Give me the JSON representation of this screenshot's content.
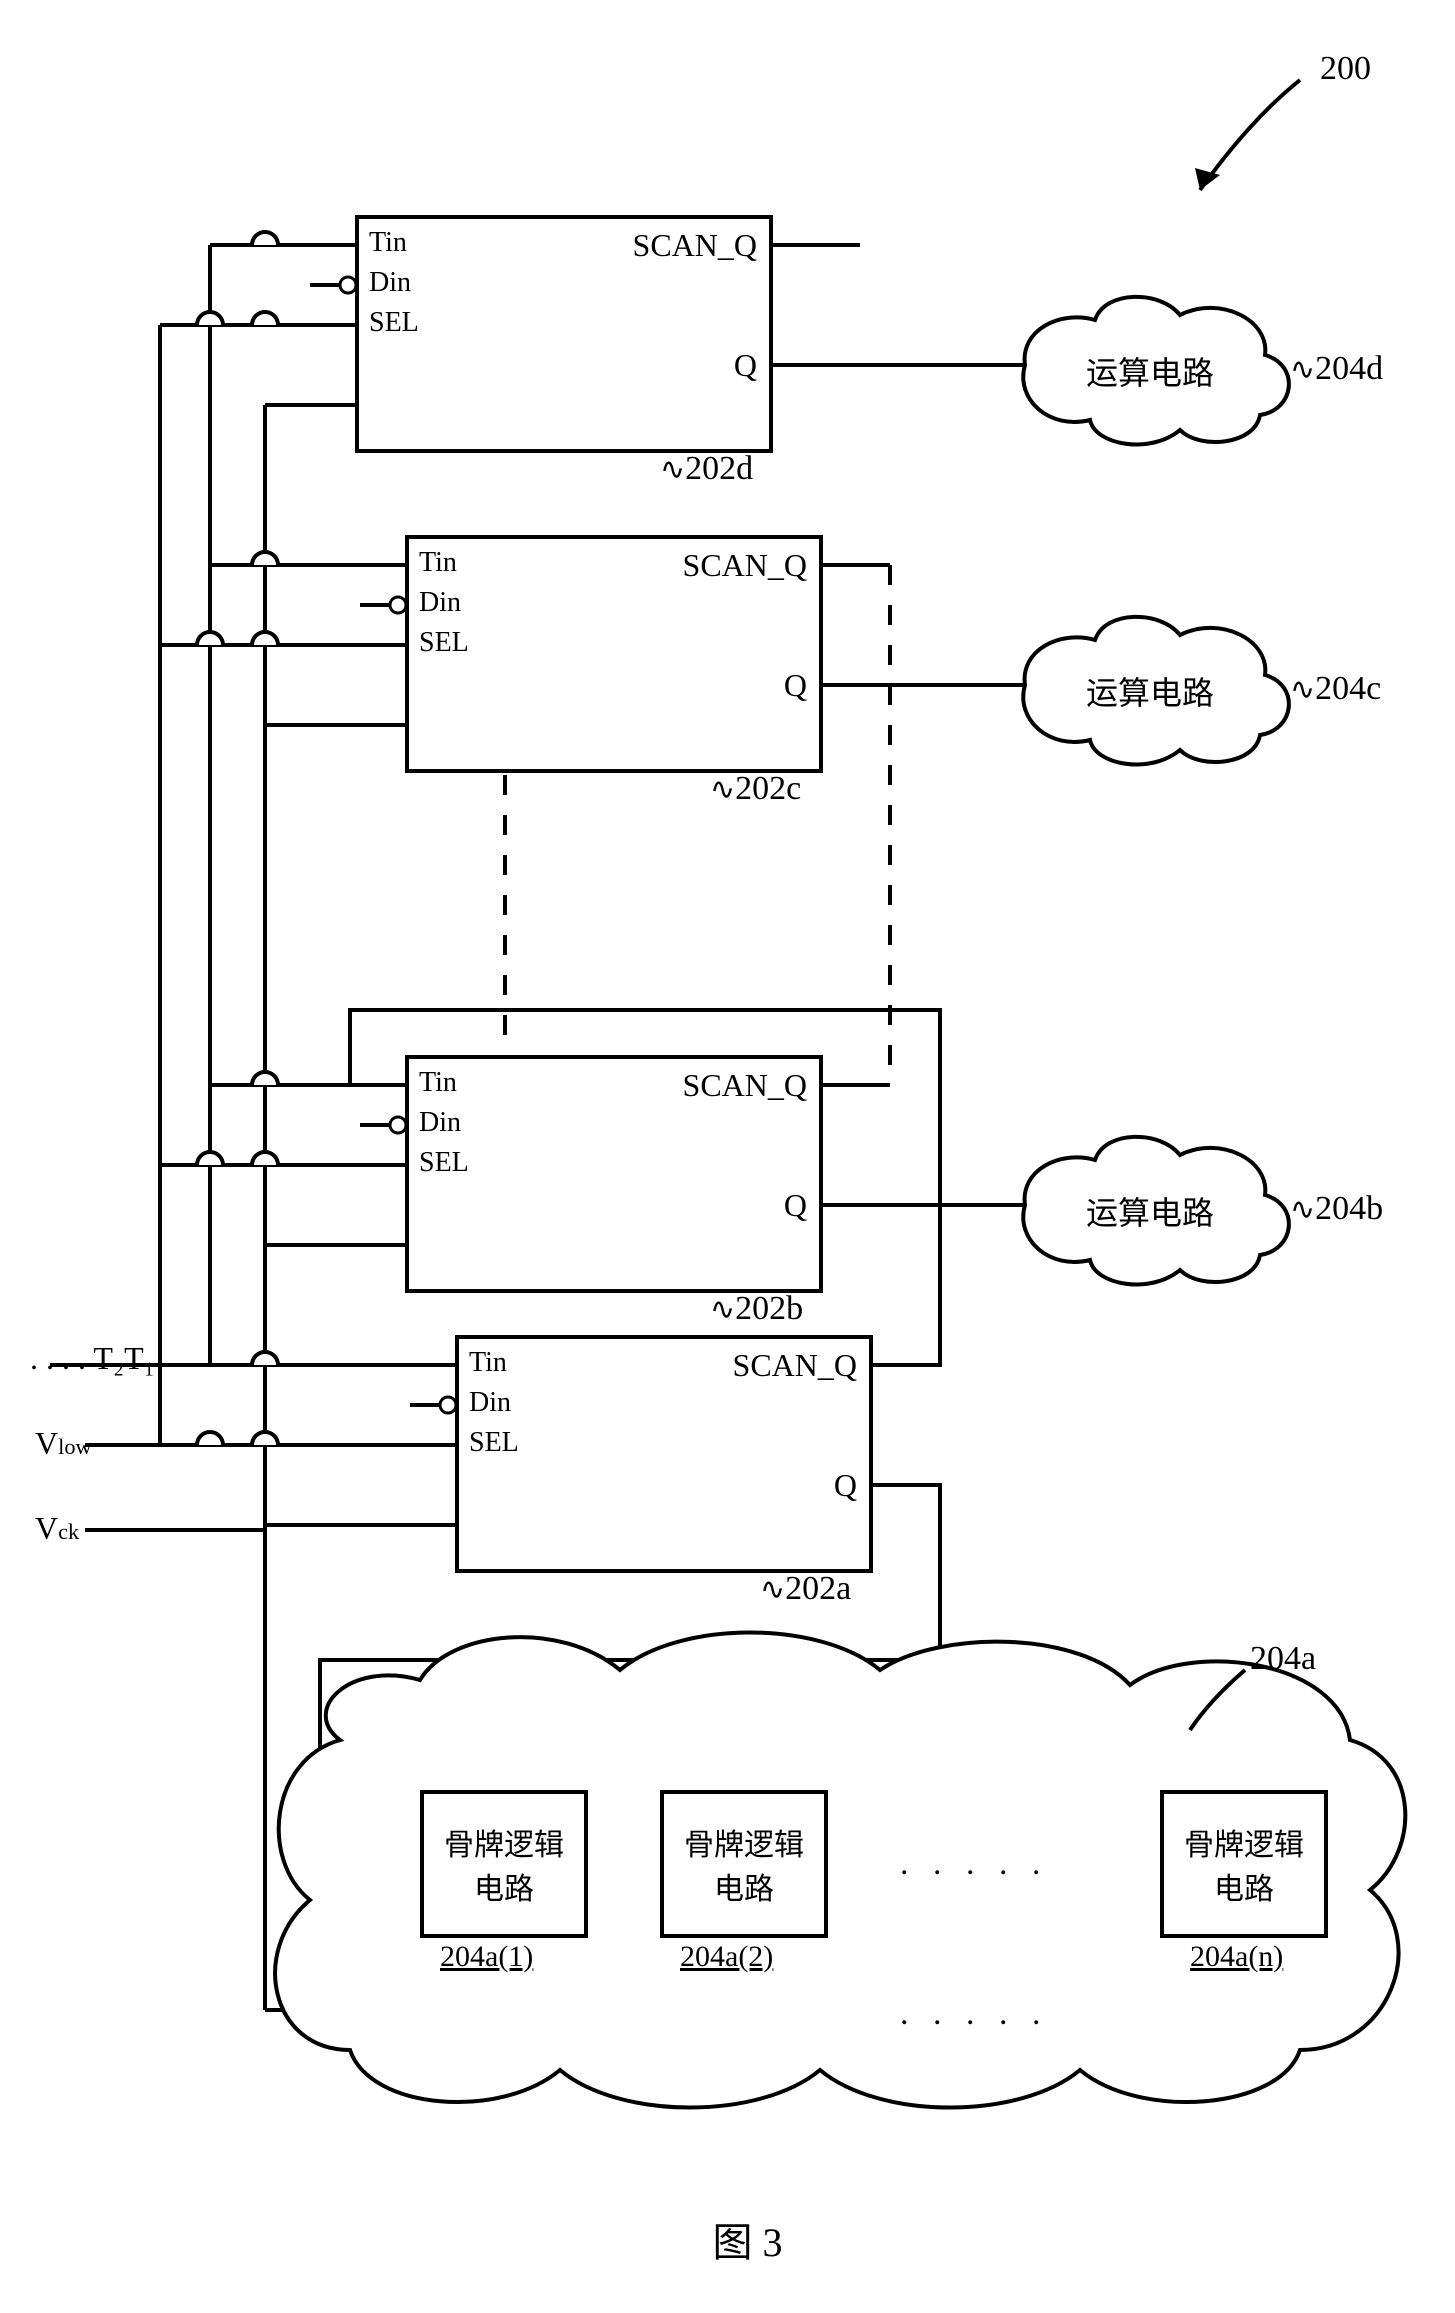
{
  "figure": {
    "label": "图 3",
    "ref": "200"
  },
  "blocks": [
    {
      "id": "202d",
      "ports": {
        "tin": "Tin",
        "din": "Din",
        "sel": "SEL",
        "scan_q": "SCAN_Q",
        "q": "Q"
      }
    },
    {
      "id": "202c",
      "ports": {
        "tin": "Tin",
        "din": "Din",
        "sel": "SEL",
        "scan_q": "SCAN_Q",
        "q": "Q"
      }
    },
    {
      "id": "202b",
      "ports": {
        "tin": "Tin",
        "din": "Din",
        "sel": "SEL",
        "scan_q": "SCAN_Q",
        "q": "Q"
      }
    },
    {
      "id": "202a",
      "ports": {
        "tin": "Tin",
        "din": "Din",
        "sel": "SEL",
        "scan_q": "SCAN_Q",
        "q": "Q"
      }
    }
  ],
  "clouds": [
    {
      "id": "204d",
      "label": "运算电路"
    },
    {
      "id": "204c",
      "label": "运算电路"
    },
    {
      "id": "204b",
      "label": "运算电路"
    },
    {
      "id": "204a",
      "label": ""
    }
  ],
  "domino_blocks": [
    {
      "id": "204a(1)",
      "label_line1": "骨牌逻辑",
      "label_line2": "电路"
    },
    {
      "id": "204a(2)",
      "label_line1": "骨牌逻辑",
      "label_line2": "电路"
    },
    {
      "id": "204a(n)",
      "label_line1": "骨牌逻辑",
      "label_line2": "电路"
    }
  ],
  "inputs": {
    "t_signals": ". . . . T₂T₁",
    "vlow": "Vlow",
    "vck": "Vck"
  },
  "dots": ". . . . ."
}
